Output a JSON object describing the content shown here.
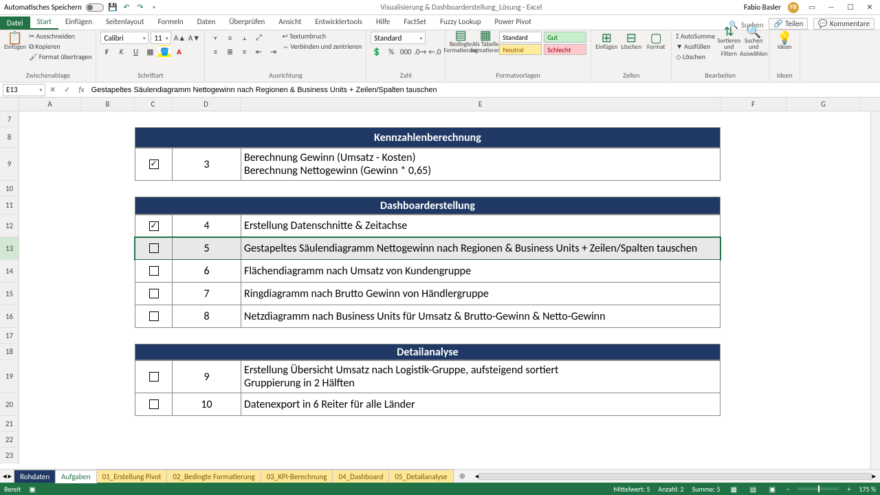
{
  "titlebar": {
    "autosave_label": "Automatisches Speichern",
    "doc_title": "Visualisierung & Dashboarderstellung_Lösung  -  Excel",
    "user_name": "Fabio Basler",
    "user_initials": "FB"
  },
  "ribbon_tabs": {
    "file": "Datei",
    "items": [
      "Start",
      "Einfügen",
      "Seitenlayout",
      "Formeln",
      "Daten",
      "Überprüfen",
      "Ansicht",
      "Entwicklertools",
      "Hilfe",
      "FactSet",
      "Fuzzy Lookup",
      "Power Pivot"
    ],
    "active": "Start",
    "search_placeholder": "Suchen",
    "share": "Teilen",
    "comments": "Kommentare"
  },
  "ribbon": {
    "clipboard": {
      "paste": "Einfügen",
      "cut": "Ausschneiden",
      "copy": "Kopieren",
      "format_painter": "Format übertragen",
      "label": "Zwischenablage"
    },
    "font": {
      "name": "Calibri",
      "size": "11",
      "label": "Schriftart"
    },
    "alignment": {
      "wrap": "Textumbruch",
      "merge": "Verbinden und zentrieren",
      "label": "Ausrichtung"
    },
    "number": {
      "format": "Standard",
      "label": "Zahl"
    },
    "styles": {
      "cond": "Bedingte Formatierung",
      "table": "Als Tabelle formatieren",
      "style_std": "Standard",
      "style_gut": "Gut",
      "style_neutral": "Neutral",
      "style_bad": "Schlecht",
      "label": "Formatvorlagen"
    },
    "cells": {
      "insert": "Einfügen",
      "delete": "Löschen",
      "format": "Format",
      "label": "Zellen"
    },
    "editing": {
      "autosum": "AutoSumme",
      "fill": "Ausfüllen",
      "clear": "Löschen",
      "sort": "Sortieren und Filtern",
      "find": "Suchen und Auswählen",
      "label": "Bearbeiten"
    },
    "ideas": {
      "label": "Ideen"
    }
  },
  "formula_bar": {
    "cell_ref": "E13",
    "formula": "Gestapeltes Säulendiagramm Nettogewinn nach Regionen & Business Units + Zeilen/Spalten tauschen"
  },
  "columns": [
    "A",
    "B",
    "C",
    "D",
    "E",
    "F",
    "G"
  ],
  "row_start": 7,
  "row_count": 17,
  "selected_row": 13,
  "sections": [
    {
      "title": "Kennzahlenberechnung",
      "rows": [
        {
          "checked": true,
          "num": "3",
          "lines": [
            "Berechnung Gewinn (Umsatz - Kosten)",
            "Berechnung Nettogewinn (Gewinn * 0,65)"
          ]
        }
      ]
    },
    {
      "title": "Dashboarderstellung",
      "rows": [
        {
          "checked": true,
          "num": "4",
          "lines": [
            "Erstellung Datenschnitte & Zeitachse"
          ]
        },
        {
          "checked": false,
          "num": "5",
          "lines": [
            "Gestapeltes Säulendiagramm Nettogewinn nach Regionen & Business Units + Zeilen/Spalten tauschen"
          ],
          "selected": true
        },
        {
          "checked": false,
          "num": "6",
          "lines": [
            "Flächendiagramm nach Umsatz von Kundengruppe"
          ]
        },
        {
          "checked": false,
          "num": "7",
          "lines": [
            "Ringdiagramm nach Brutto Gewinn von Händlergruppe"
          ]
        },
        {
          "checked": false,
          "num": "8",
          "lines": [
            "Netzdiagramm nach Business Units für Umsatz & Brutto-Gewinn & Netto-Gewinn"
          ]
        }
      ]
    },
    {
      "title": "Detailanalyse",
      "rows": [
        {
          "checked": false,
          "num": "9",
          "lines": [
            "Erstellung Übersicht Umsatz nach Logistik-Gruppe, aufsteigend sortiert",
            "Gruppierung in 2 Hälften"
          ]
        },
        {
          "checked": false,
          "num": "10",
          "lines": [
            "Datenexport in 6 Reiter für alle Länder"
          ]
        }
      ]
    }
  ],
  "sheet_tabs": {
    "items": [
      {
        "label": "Rohdaten",
        "style": "blue"
      },
      {
        "label": "Aufgaben",
        "style": "active"
      },
      {
        "label": "01_Erstellung Pivot",
        "style": "yellow"
      },
      {
        "label": "02_Bedingte Formatierung",
        "style": "yellow"
      },
      {
        "label": "03_KPI-Berechnung",
        "style": "yellow"
      },
      {
        "label": "04_Dashboard",
        "style": "yellow"
      },
      {
        "label": "05_Detailanalyse",
        "style": "yellow"
      }
    ]
  },
  "status": {
    "ready": "Bereit",
    "avg": "Mittelwert: 5",
    "count": "Anzahl: 2",
    "sum": "Summe: 5",
    "zoom": "175 %"
  }
}
